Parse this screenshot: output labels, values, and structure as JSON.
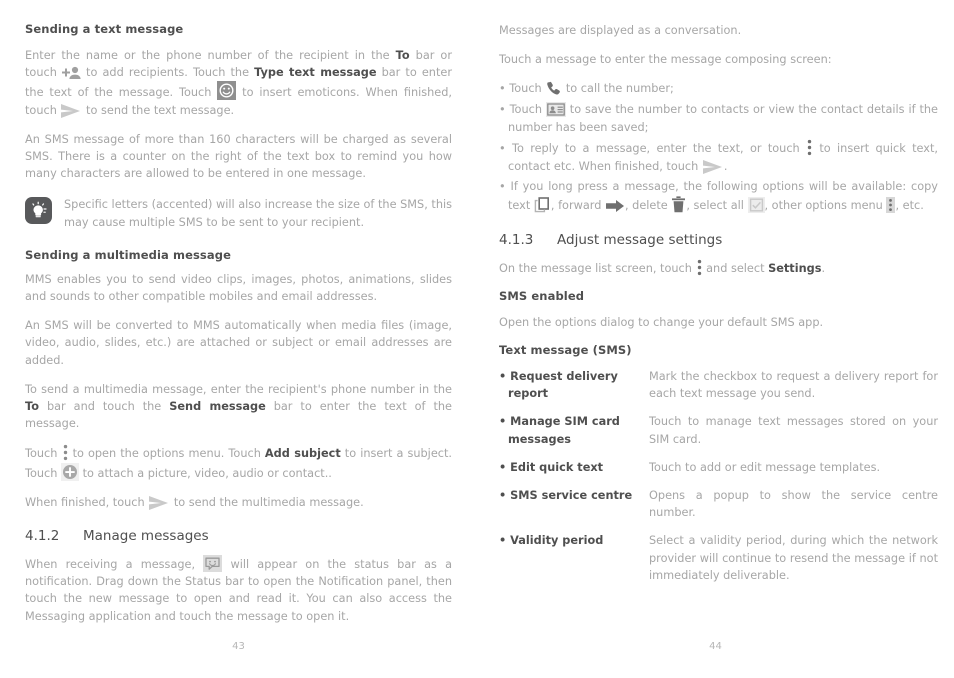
{
  "document": {
    "type": "user-manual-spread",
    "text_color": "#a6a6a6",
    "heading_color": "#4f4f4f",
    "tip_icon_color": "#58595b"
  },
  "left_page": {
    "folio": "43",
    "heading_1": "Sending a text message",
    "para_1": {
      "seg_1": "Enter the name or the phone number of the recipient in the ",
      "bold_1": "To",
      "seg_2": " bar or touch ",
      "icon_1": "add-recipient-icon",
      "seg_3": " to add recipients. Touch the ",
      "bold_2": "Type text message",
      "seg_4": " bar to enter the text of the message. Touch ",
      "icon_2": "emoticon-icon",
      "seg_5": " to insert emoticons. When finished, touch ",
      "icon_3": "send-icon",
      "seg_6": " to send the text message."
    },
    "para_2": "An SMS message of more than 160 characters will be charged as several SMS. There is a counter on the right of the text box to remind you how many characters are allowed to be entered in one message.",
    "tip": {
      "icon": "tip-lightbulb-icon",
      "text": "Specific letters (accented) will also increase the size of the SMS, this may cause multiple SMS to be sent to your recipient."
    },
    "heading_2": "Sending a multimedia message",
    "para_3": "MMS enables you to send video clips, images, photos, animations, slides and sounds to other compatible mobiles and email addresses.",
    "para_4": "An SMS will be converted to MMS automatically when media files (image, video, audio, slides, etc.) are attached or subject or email addresses are added.",
    "para_5": {
      "seg_1": "To send a multimedia message, enter the recipient's phone number in the ",
      "bold_1": "To",
      "seg_2": " bar and touch the ",
      "bold_2": "Send message",
      "seg_3": " bar to enter the text of the message."
    },
    "para_6": {
      "seg_1": "Touch ",
      "icon_1": "overflow-menu-icon",
      "seg_2": " to open the options menu. Touch ",
      "bold_1": "Add subject",
      "seg_3": " to insert a subject. Touch ",
      "icon_2": "attach-plus-icon",
      "seg_4": " to attach a picture, video, audio or contact.."
    },
    "para_7": {
      "seg_1": "When finished, touch ",
      "icon_1": "send-icon",
      "seg_2": " to send the multimedia message."
    },
    "section": {
      "number": "4.1.2",
      "title": "Manage messages"
    },
    "para_8": {
      "seg_1": "When receiving a message, ",
      "icon_1": "message-notification-icon",
      "seg_2": " will appear on the status bar as a notification. Drag down the Status bar to open the Notification panel, then touch the new message to open and read it. You can also access the Messaging application and touch the message to open it."
    }
  },
  "right_page": {
    "folio": "44",
    "para_1": "Messages are displayed as a conversation.",
    "para_2": "Touch a message to enter the message composing screen:",
    "bullets": [
      {
        "seg_1": "Touch ",
        "icon_1": "phone-icon",
        "seg_2": " to call the number;"
      },
      {
        "seg_1": "Touch ",
        "icon_1": "contact-card-icon",
        "seg_2": " to save the number to contacts or view the contact details if the number has been saved;"
      },
      {
        "seg_1": "To reply to a message, enter the text, or touch ",
        "icon_1": "overflow-menu-icon",
        "seg_2": " to insert quick text, contact etc. When finished, touch ",
        "icon_2": "send-icon",
        "seg_3": "."
      },
      {
        "seg_1": "If you long press a message, the following options will be available: copy text ",
        "icon_1": "copy-icon",
        "seg_2": ", forward ",
        "icon_2": "forward-arrow-icon",
        "seg_3": ", delete ",
        "icon_3": "trash-icon",
        "seg_4": ", select all ",
        "icon_4": "select-all-checkbox-icon",
        "seg_5": ", other options menu ",
        "icon_5": "overflow-menu-boxed-icon",
        "seg_6": ", etc."
      }
    ],
    "section": {
      "number": "4.1.3",
      "title": "Adjust message settings"
    },
    "para_3": {
      "seg_1": "On the message list screen, touch ",
      "icon_1": "overflow-menu-icon",
      "seg_2": " and select ",
      "bold_1": "Settings",
      "seg_3": "."
    },
    "heading_1": "SMS enabled",
    "para_4": "Open the options dialog to change your default SMS app.",
    "heading_2": "Text message (SMS)",
    "settings": [
      {
        "term": "Request delivery report",
        "desc": "Mark the checkbox to request a delivery report for each text message you send."
      },
      {
        "term": "Manage SIM card messages",
        "desc": "Touch to manage text messages stored on your SIM card."
      },
      {
        "term": "Edit quick text",
        "desc": "Touch to add or edit message templates."
      },
      {
        "term": "SMS service centre",
        "desc": "Opens a popup to show the service centre number."
      },
      {
        "term": "Validity period",
        "desc": "Select a validity period, during which the network provider will continue to resend the message if not immediately deliverable."
      }
    ]
  }
}
